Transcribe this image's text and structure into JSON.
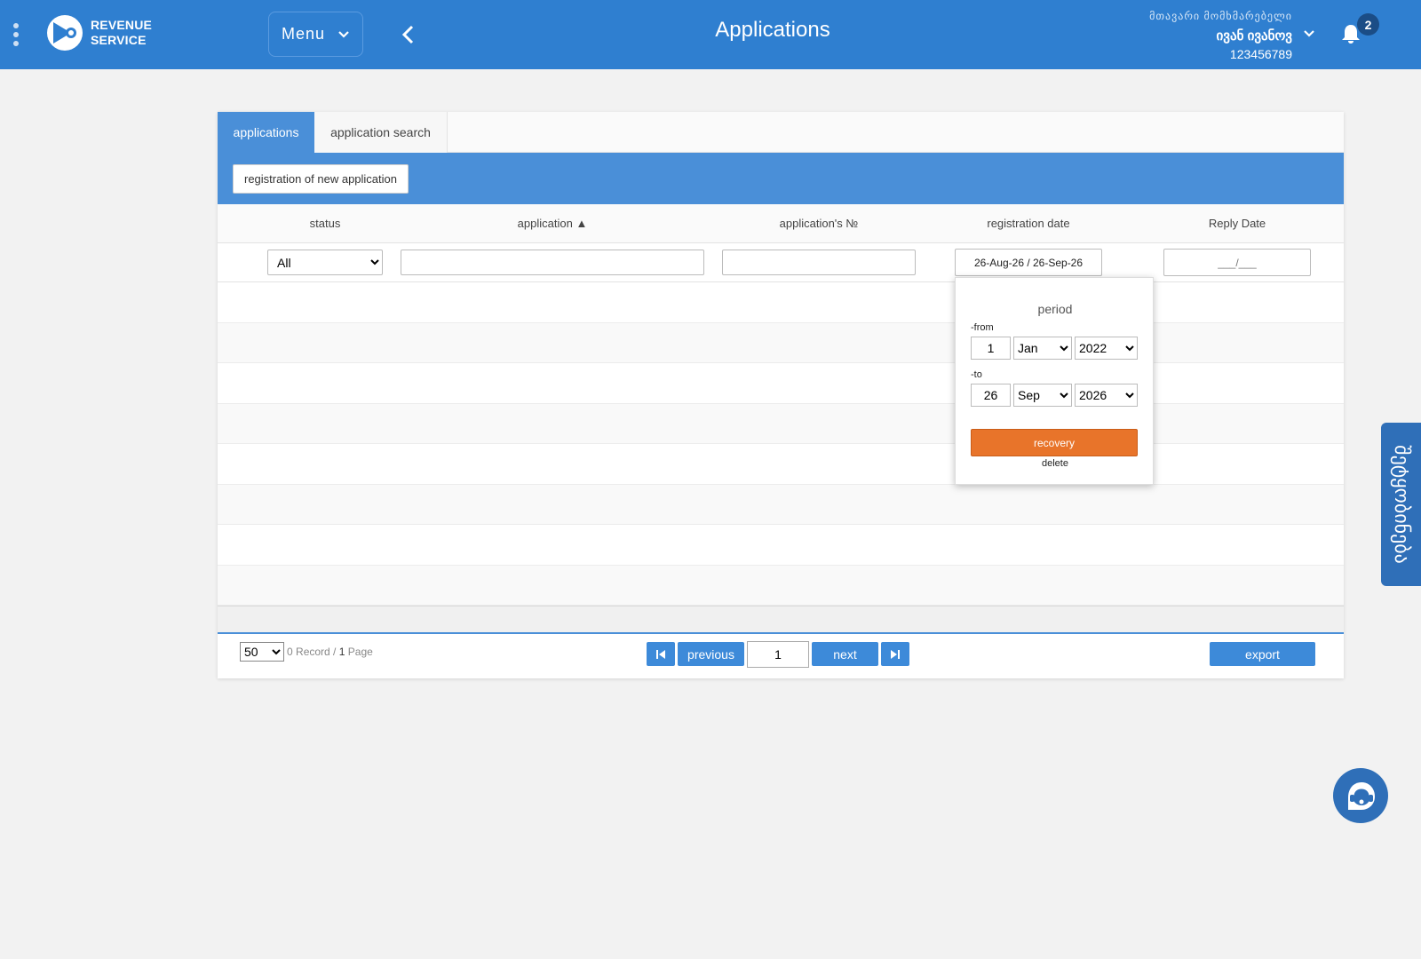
{
  "header": {
    "brand_line1": "REVENUE",
    "brand_line2": "SERVICE",
    "menu_label": "Menu",
    "page_title": "Applications",
    "user_role": "მთავარი მომხმარებელი",
    "user_name": "ივან ივანოვ",
    "user_id": "123456789",
    "notification_count": "2"
  },
  "tabs": [
    {
      "label": "applications",
      "active": true
    },
    {
      "label": "application search",
      "active": false
    }
  ],
  "toolbar": {
    "new_application_label": "registration of new application"
  },
  "table": {
    "columns": [
      {
        "label": "status"
      },
      {
        "label": "application ▲"
      },
      {
        "label": "application's №"
      },
      {
        "label": "registration date"
      },
      {
        "label": "Reply Date"
      }
    ],
    "filters": {
      "status_value": "All",
      "status_options": [
        "All"
      ],
      "application_value": "",
      "application_no_value": "",
      "registration_date_value": "26-Aug-26 / 26-Sep-26",
      "reply_date_placeholder": "___/___"
    },
    "rows": []
  },
  "period_popup": {
    "title": "period",
    "from_label": "-from",
    "from_day": "1",
    "from_month": "Jan",
    "from_year": "2022",
    "to_label": "-to",
    "to_day": "26",
    "to_month": "Sep",
    "to_year": "2026",
    "recovery_label": "recovery",
    "delete_label": "delete"
  },
  "pager": {
    "page_size": "50",
    "record_count": "0",
    "record_label": "Record /",
    "page_count": "1",
    "page_label": "Page",
    "previous_label": "previous",
    "current_page": "1",
    "next_label": "next",
    "export_label": "export"
  },
  "side_tab": {
    "label": "შეტყობინება"
  },
  "colors": {
    "header_bg": "#2f7fd0",
    "toolbar_bg": "#4a8fd8",
    "button_blue": "#3d8ad9",
    "recovery_orange": "#e8742a",
    "side_tab_bg": "#2f6fb8"
  },
  "icons": [
    "kebab-menu-icon",
    "logo-icon",
    "chevron-down-icon",
    "chevron-left-icon",
    "bell-icon",
    "first-page-icon",
    "last-page-icon",
    "chat-support-icon"
  ]
}
